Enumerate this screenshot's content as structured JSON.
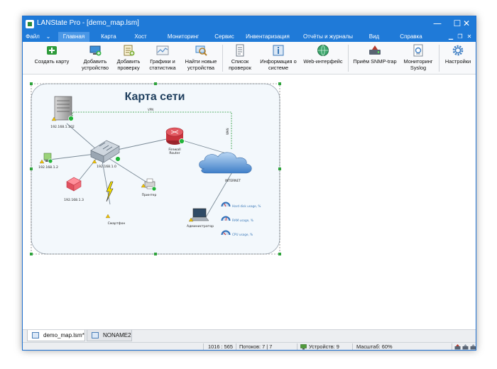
{
  "window": {
    "title": "LANState Pro - [demo_map.lsm]",
    "controls": {
      "minimize": "—",
      "maximize": "☐",
      "close": "✕"
    }
  },
  "menu": {
    "items": [
      {
        "label": "Файл",
        "active": false
      },
      {
        "label": "⌄",
        "active": false
      },
      {
        "label": "Главная",
        "active": true
      },
      {
        "label": "Карта",
        "active": false
      },
      {
        "label": "Хост",
        "active": false
      },
      {
        "label": "Мониторинг",
        "active": false
      },
      {
        "label": "Сервис",
        "active": false
      },
      {
        "label": "Инвентаризация",
        "active": false
      },
      {
        "label": "Отчёты и журналы",
        "active": false
      },
      {
        "label": "Вид",
        "active": false
      },
      {
        "label": "Справка",
        "active": false
      }
    ],
    "mdi_controls": [
      "▁",
      "❐",
      "✕"
    ]
  },
  "toolbar": {
    "buttons": [
      {
        "name": "create-map",
        "label": "Создать карту",
        "icon": "create-map-icon",
        "color": "#2e9b3b"
      },
      {
        "name": "add-device",
        "label": "Добавить\nустройство",
        "icon": "add-device-icon",
        "color": "#3f8fd6"
      },
      {
        "name": "add-check",
        "label": "Добавить\nпроверку",
        "icon": "add-check-icon",
        "color": "#7fb23a"
      },
      {
        "name": "graphs-stats",
        "label": "Графики и\nстатистика",
        "icon": "graph-icon",
        "color": "#8a94a3"
      },
      {
        "name": "find-new-devices",
        "label": "Найти новые\nустройства",
        "icon": "find-devices-icon",
        "color": "#3a84c8"
      },
      {
        "name": "checks-list",
        "label": "Список\nпроверок",
        "icon": "checklist-icon",
        "color": "#6c7786"
      },
      {
        "name": "system-info",
        "label": "Информация о\nсистеме",
        "icon": "system-info-icon",
        "color": "#3a78b8"
      },
      {
        "name": "web-interface",
        "label": "Web-интерфейс",
        "icon": "globe-icon",
        "color": "#2f8f5a"
      },
      {
        "name": "snmp-trap",
        "label": "Приём SNMP-trap",
        "icon": "snmp-trap-icon",
        "color": "#b43a2e"
      },
      {
        "name": "syslog-monitor",
        "label": "Мониторинг\nSyslog",
        "icon": "syslog-icon",
        "color": "#7d8896"
      },
      {
        "name": "settings",
        "label": "Настройки",
        "icon": "gear-icon",
        "color": "#3f7fc4"
      }
    ]
  },
  "map": {
    "title": "Карта сети",
    "devices": [
      {
        "name": "server",
        "label": "192.168.1.102",
        "icon": "server-icon"
      },
      {
        "name": "switch",
        "label": "192.168.1.0",
        "icon": "switch-icon"
      },
      {
        "name": "router",
        "label": "Firewall\nRouter",
        "icon": "router-icon"
      },
      {
        "name": "internet",
        "label": "INTERNET",
        "icon": "cloud-icon"
      },
      {
        "name": "host-1-2",
        "label": "192.168.1.2",
        "icon": "pc-icon"
      },
      {
        "name": "host-1-3",
        "label": "192.168.1.3",
        "icon": "pc-icon"
      },
      {
        "name": "smartphone",
        "label": "Смартфон",
        "icon": "smartphone-icon"
      },
      {
        "name": "printer",
        "label": "Принтер",
        "icon": "printer-icon"
      },
      {
        "name": "admin",
        "label": "Администратор",
        "icon": "laptop-icon"
      }
    ],
    "link_labels": {
      "vpn": "VPN",
      "wan": "WAN"
    },
    "gauges": [
      {
        "label": "Hard disk usage, %",
        "value": 0.35
      },
      {
        "label": "RAM usage, %",
        "value": 0.55
      },
      {
        "label": "CPU usage, %",
        "value": 0.25
      }
    ],
    "colors": {
      "node_ok": "#22b43a",
      "warning": "#f0c000",
      "router": "#c8323c",
      "cloud": "#4f8ed4"
    }
  },
  "tabs": [
    {
      "label": "demo_map.lsm*",
      "active": true
    },
    {
      "label": "NONAME2",
      "active": false
    }
  ],
  "status": {
    "coords": "1016 : 565",
    "threads": "Потоков: 7 | 7",
    "devices": "Устройств: 9",
    "scale": "Масштаб: 60%"
  }
}
